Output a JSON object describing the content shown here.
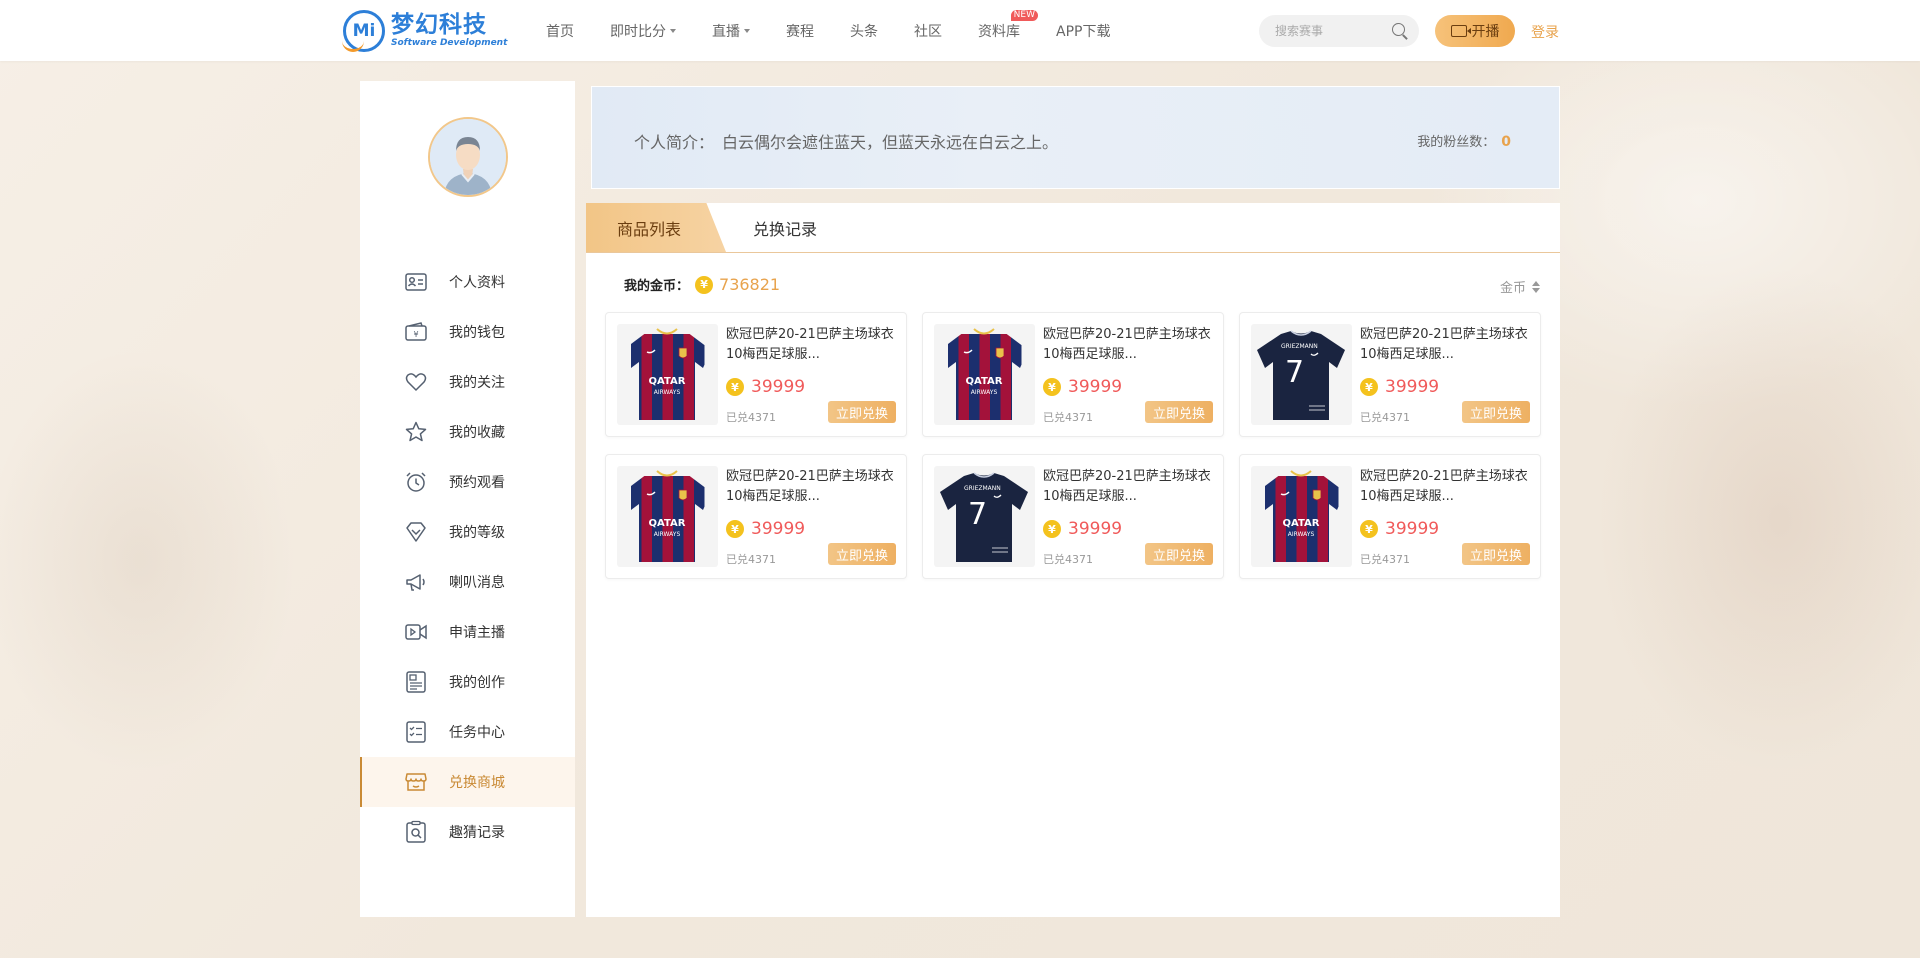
{
  "brand": {
    "name_cn": "梦幻科技",
    "name_en": "Software Development",
    "mark": "Mi"
  },
  "nav": {
    "items": [
      {
        "label": "首页",
        "dropdown": false
      },
      {
        "label": "即时比分",
        "dropdown": true
      },
      {
        "label": "直播",
        "dropdown": true
      },
      {
        "label": "赛程",
        "dropdown": false
      },
      {
        "label": "头条",
        "dropdown": false
      },
      {
        "label": "社区",
        "dropdown": false
      },
      {
        "label": "资料库",
        "dropdown": false,
        "badge": "NEW"
      },
      {
        "label": "APP下载",
        "dropdown": false
      }
    ],
    "search_placeholder": "搜索赛事",
    "live_button": "开播",
    "login": "登录"
  },
  "sidebar": {
    "items": [
      {
        "label": "个人资料",
        "icon": "profile-card-icon",
        "active": false
      },
      {
        "label": "我的钱包",
        "icon": "wallet-icon",
        "active": false
      },
      {
        "label": "我的关注",
        "icon": "heart-icon",
        "active": false
      },
      {
        "label": "我的收藏",
        "icon": "star-icon",
        "active": false
      },
      {
        "label": "预约观看",
        "icon": "alarm-clock-icon",
        "active": false
      },
      {
        "label": "我的等级",
        "icon": "diamond-icon",
        "active": false
      },
      {
        "label": "喇叭消息",
        "icon": "megaphone-icon",
        "active": false
      },
      {
        "label": "申请主播",
        "icon": "video-icon",
        "active": false
      },
      {
        "label": "我的创作",
        "icon": "creation-icon",
        "active": false
      },
      {
        "label": "任务中心",
        "icon": "task-list-icon",
        "active": false
      },
      {
        "label": "兑换商城",
        "icon": "shop-icon",
        "active": true
      },
      {
        "label": "趣猜记录",
        "icon": "record-search-icon",
        "active": false
      }
    ]
  },
  "profile": {
    "intro_label": "个人简介：",
    "intro_text": "白云偶尔会遮住蓝天，但蓝天永远在白云之上。",
    "fans_label": "我的粉丝数：",
    "fans_count": "0"
  },
  "shop": {
    "tabs": [
      {
        "label": "商品列表",
        "active": true
      },
      {
        "label": "兑换记录",
        "active": false
      }
    ],
    "coins_label": "我的金币：",
    "coin_symbol": "¥",
    "coins_value": "736821",
    "sort_label": "金币",
    "products": [
      {
        "title": "欧冠巴萨20-21巴萨主场球衣10梅西足球服...",
        "price": "39999",
        "sold": "已兑4371",
        "button": "立即兑换",
        "jersey": "barca"
      },
      {
        "title": "欧冠巴萨20-21巴萨主场球衣10梅西足球服...",
        "price": "39999",
        "sold": "已兑4371",
        "button": "立即兑换",
        "jersey": "barca"
      },
      {
        "title": "欧冠巴萨20-21巴萨主场球衣10梅西足球服...",
        "price": "39999",
        "sold": "已兑4371",
        "button": "立即兑换",
        "jersey": "france"
      },
      {
        "title": "欧冠巴萨20-21巴萨主场球衣10梅西足球服...",
        "price": "39999",
        "sold": "已兑4371",
        "button": "立即兑换",
        "jersey": "barca"
      },
      {
        "title": "欧冠巴萨20-21巴萨主场球衣10梅西足球服...",
        "price": "39999",
        "sold": "已兑4371",
        "button": "立即兑换",
        "jersey": "france"
      },
      {
        "title": "欧冠巴萨20-21巴萨主场球衣10梅西足球服...",
        "price": "39999",
        "sold": "已兑4371",
        "button": "立即兑换",
        "jersey": "barca"
      }
    ]
  },
  "colors": {
    "accent": "#e8a34d",
    "price": "#f05a5a",
    "brand_blue": "#2d7fd8"
  }
}
